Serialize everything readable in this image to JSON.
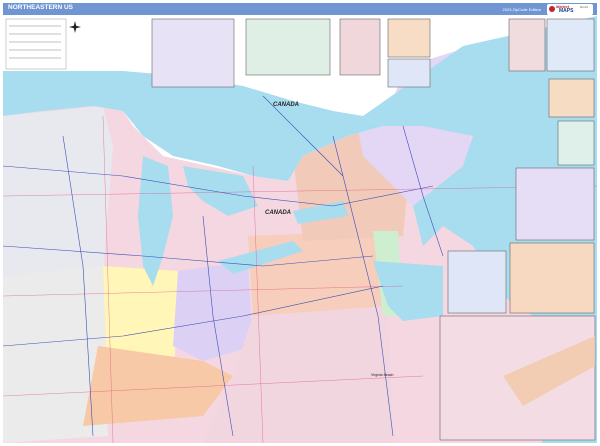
{
  "header": {
    "title": "NORTHEASTERN US",
    "edition": "2023 ZipCode Edition"
  },
  "logo": {
    "line1": "Market",
    "line2": "MAPS",
    "line3": "Sm Ft"
  },
  "map": {
    "labels": {
      "canada_north": "CANADA",
      "canada_south": "CANADA",
      "virginia_beach": "Virginia Beach"
    },
    "colors": {
      "water": "#a8dcef",
      "canada_land": "#ffffff",
      "accent_title": "#6f95d3",
      "logo_red": "#c0272d",
      "logo_blue": "#1b3f8b"
    },
    "icons": [
      "compass-rose-icon",
      "logo-icon"
    ]
  }
}
